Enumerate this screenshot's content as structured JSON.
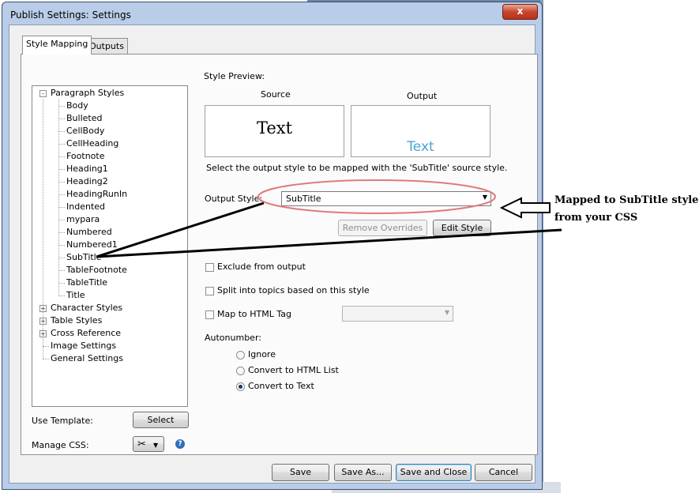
{
  "window": {
    "title": "Publish Settings: Settings",
    "close_glyph": "x"
  },
  "tabs": [
    {
      "label": "Style Mapping",
      "active": true
    },
    {
      "label": "Outputs",
      "active": false
    }
  ],
  "tree": {
    "paragraph_styles": {
      "label": "Paragraph Styles",
      "expander": "-",
      "items": [
        "Body",
        "Bulleted",
        "CellBody",
        "CellHeading",
        "Footnote",
        "Heading1",
        "Heading2",
        "HeadingRunIn",
        "Indented",
        "mypara",
        "Numbered",
        "Numbered1",
        "SubTitle",
        "TableFootnote",
        "TableTitle",
        "Title"
      ]
    },
    "collapsed": [
      {
        "label": "Character Styles",
        "expander": "+"
      },
      {
        "label": "Table Styles",
        "expander": "+"
      },
      {
        "label": "Cross Reference",
        "expander": "+"
      },
      {
        "label": "Image Settings",
        "expander": ""
      },
      {
        "label": "General Settings",
        "expander": ""
      }
    ]
  },
  "preview": {
    "heading": "Style Preview:",
    "source_label": "Source",
    "output_label": "Output",
    "source_text": "Text",
    "output_text": "Text",
    "output_color": "#4aa3d4",
    "description": "Select the output style to be mapped with the 'SubTitle' source style."
  },
  "output_style": {
    "label": "Output Style:",
    "value": "SubTitle"
  },
  "buttons": {
    "remove_overrides": "Remove Overrides",
    "edit_style": "Edit Style",
    "select": "Select",
    "save": "Save",
    "save_as": "Save As...",
    "save_close": "Save and Close",
    "cancel": "Cancel"
  },
  "options": {
    "exclude": {
      "label": "Exclude from output",
      "checked": false
    },
    "split": {
      "label": "Split into topics based on this style",
      "checked": false
    },
    "map_html": {
      "label": "Map to HTML Tag",
      "checked": false,
      "value": ""
    }
  },
  "autonumber": {
    "label": "Autonumber:",
    "options": [
      {
        "label": "Ignore",
        "selected": false
      },
      {
        "label": "Convert to HTML List",
        "selected": false
      },
      {
        "label": "Convert to Text",
        "selected": true
      }
    ]
  },
  "footer": {
    "use_template": "Use Template:",
    "manage_css": "Manage CSS:",
    "help_glyph": "?"
  },
  "annotation": {
    "line1": "Mapped to SubTitle style",
    "line2": "from your CSS",
    "highlight_color": "#e07a7a"
  }
}
